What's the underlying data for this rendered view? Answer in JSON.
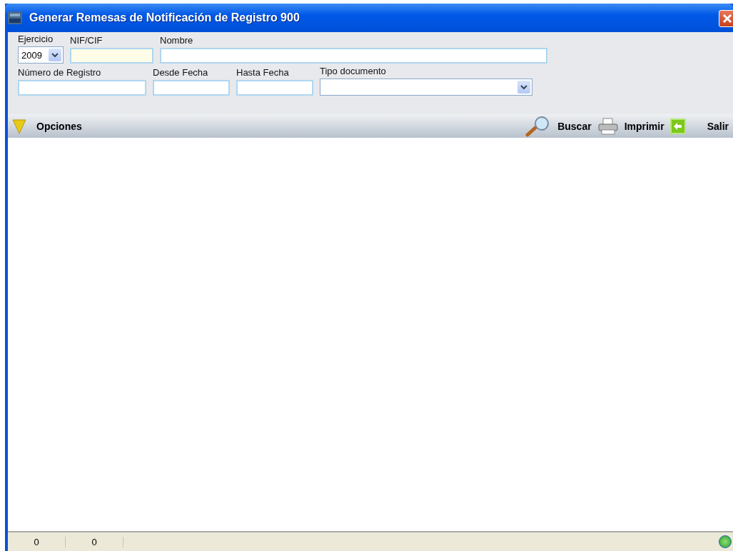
{
  "window": {
    "title": "Generar Remesas de Notificación de Registro 900"
  },
  "filter_rows": [
    [
      {
        "kind": "select",
        "label": "Ejercicio",
        "value": "2009"
      },
      {
        "kind": "input",
        "label": "NIF/CIF",
        "highlight": true
      },
      {
        "kind": "input",
        "label": "Nombre",
        "highlight": false
      }
    ],
    [
      {
        "kind": "input",
        "label": "Número de Registro",
        "highlight": false
      },
      {
        "kind": "input",
        "label": "Desde Fecha",
        "highlight": false
      },
      {
        "kind": "input",
        "label": "Hasta Fecha",
        "highlight": false
      },
      {
        "kind": "select",
        "label": "Tipo documento"
      }
    ]
  ],
  "toolbar": {
    "options": "Opciones",
    "actions": [
      {
        "label": "Buscar"
      },
      {
        "label": "Imprimir"
      },
      {
        "label": "Salir"
      }
    ]
  },
  "status_bar": [
    "0",
    "0"
  ]
}
